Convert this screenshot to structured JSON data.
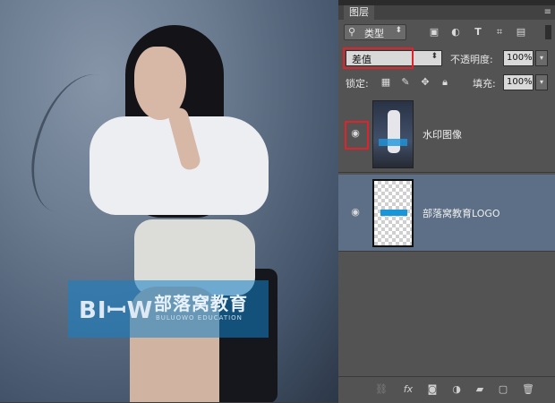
{
  "canvas": {
    "watermark": {
      "logo_text": "BIꟷW",
      "cn_text": "部落窝教育",
      "en_text": "BULUOWO EDUCATION"
    }
  },
  "panel": {
    "tab_label": "图层",
    "menu_glyph": "≡",
    "filter": {
      "search_glyph": "⚲",
      "kind_label": "类型",
      "filter_icons": [
        "image-filter-icon",
        "adjustment-filter-icon",
        "type-filter-icon",
        "shape-filter-icon",
        "smart-object-filter-icon"
      ]
    },
    "blend_mode": "差值",
    "opacity_label": "不透明度:",
    "opacity_value": "100%",
    "lock_label": "锁定:",
    "fill_label": "填充:",
    "fill_value": "100%",
    "layers": [
      {
        "name": "水印图像",
        "visible": true,
        "selected": false
      },
      {
        "name": "部落窝教育LOGO",
        "visible": true,
        "selected": true
      }
    ],
    "bottom_icons": [
      "link-icon",
      "fx-icon",
      "mask-icon",
      "adjustment-icon",
      "group-icon",
      "new-layer-icon",
      "delete-icon"
    ],
    "fx_label": "fx",
    "highlight_color": "#e0232a"
  }
}
